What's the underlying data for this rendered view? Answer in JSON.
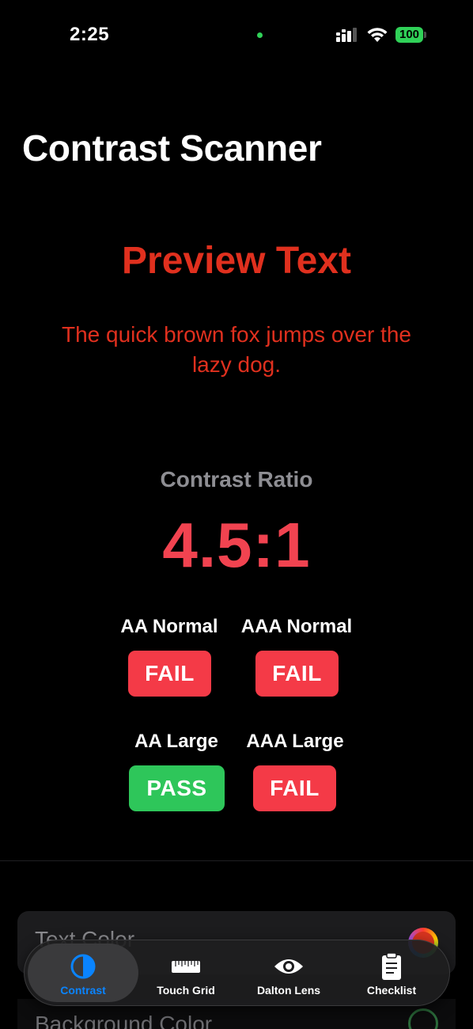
{
  "status_bar": {
    "time": "2:25",
    "battery": "100"
  },
  "header": {
    "title": "Contrast Scanner"
  },
  "preview": {
    "title": "Preview Text",
    "body": "The quick brown fox jumps over the lazy dog.",
    "text_color": "#e0301e"
  },
  "ratio": {
    "label": "Contrast Ratio",
    "value": "4.5:1"
  },
  "levels": [
    {
      "label": "AA Normal",
      "result": "FAIL"
    },
    {
      "label": "AAA Normal",
      "result": "FAIL"
    },
    {
      "label": "AA Large",
      "result": "PASS"
    },
    {
      "label": "AAA Large",
      "result": "FAIL"
    }
  ],
  "settings": {
    "text_color_label": "Text Color",
    "background_color_label": "Background Color"
  },
  "tabs": [
    {
      "label": "Contrast",
      "icon": "contrast-icon",
      "active": true
    },
    {
      "label": "Touch Grid",
      "icon": "ruler-icon",
      "active": false
    },
    {
      "label": "Dalton Lens",
      "icon": "eye-icon",
      "active": false
    },
    {
      "label": "Checklist",
      "icon": "clipboard-icon",
      "active": false
    }
  ],
  "colors": {
    "pass": "#2ec65a",
    "fail": "#f43a47",
    "accent": "#0a84ff",
    "ratio": "#f14350"
  }
}
